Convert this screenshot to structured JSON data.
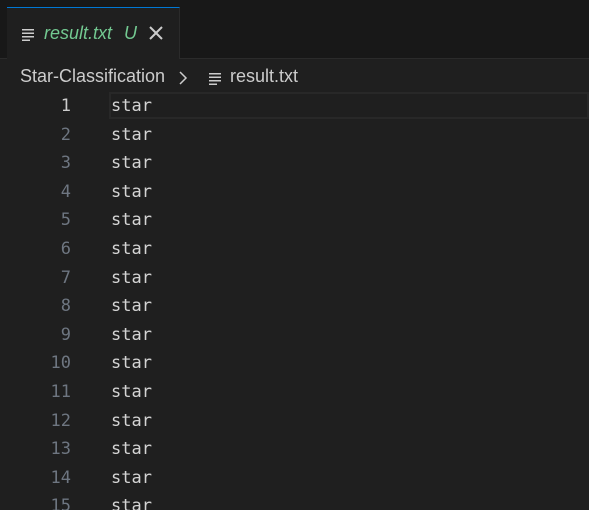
{
  "tab": {
    "filename": "result.txt",
    "status": "U",
    "icon": "lines-icon",
    "close_icon": "close-icon"
  },
  "breadcrumb": {
    "folder": "Star-Classification",
    "file": "result.txt"
  },
  "editor": {
    "lines": [
      {
        "num": "1",
        "text": "star"
      },
      {
        "num": "2",
        "text": "star"
      },
      {
        "num": "3",
        "text": "star"
      },
      {
        "num": "4",
        "text": "star"
      },
      {
        "num": "5",
        "text": "star"
      },
      {
        "num": "6",
        "text": "star"
      },
      {
        "num": "7",
        "text": "star"
      },
      {
        "num": "8",
        "text": "star"
      },
      {
        "num": "9",
        "text": "star"
      },
      {
        "num": "10",
        "text": "star"
      },
      {
        "num": "11",
        "text": "star"
      },
      {
        "num": "12",
        "text": "star"
      },
      {
        "num": "13",
        "text": "star"
      },
      {
        "num": "14",
        "text": "star"
      },
      {
        "num": "15",
        "text": "star"
      }
    ],
    "active_line": "1"
  },
  "colors": {
    "accent": "#0078d4",
    "untracked": "#73c991",
    "background": "#1f1f1f"
  }
}
